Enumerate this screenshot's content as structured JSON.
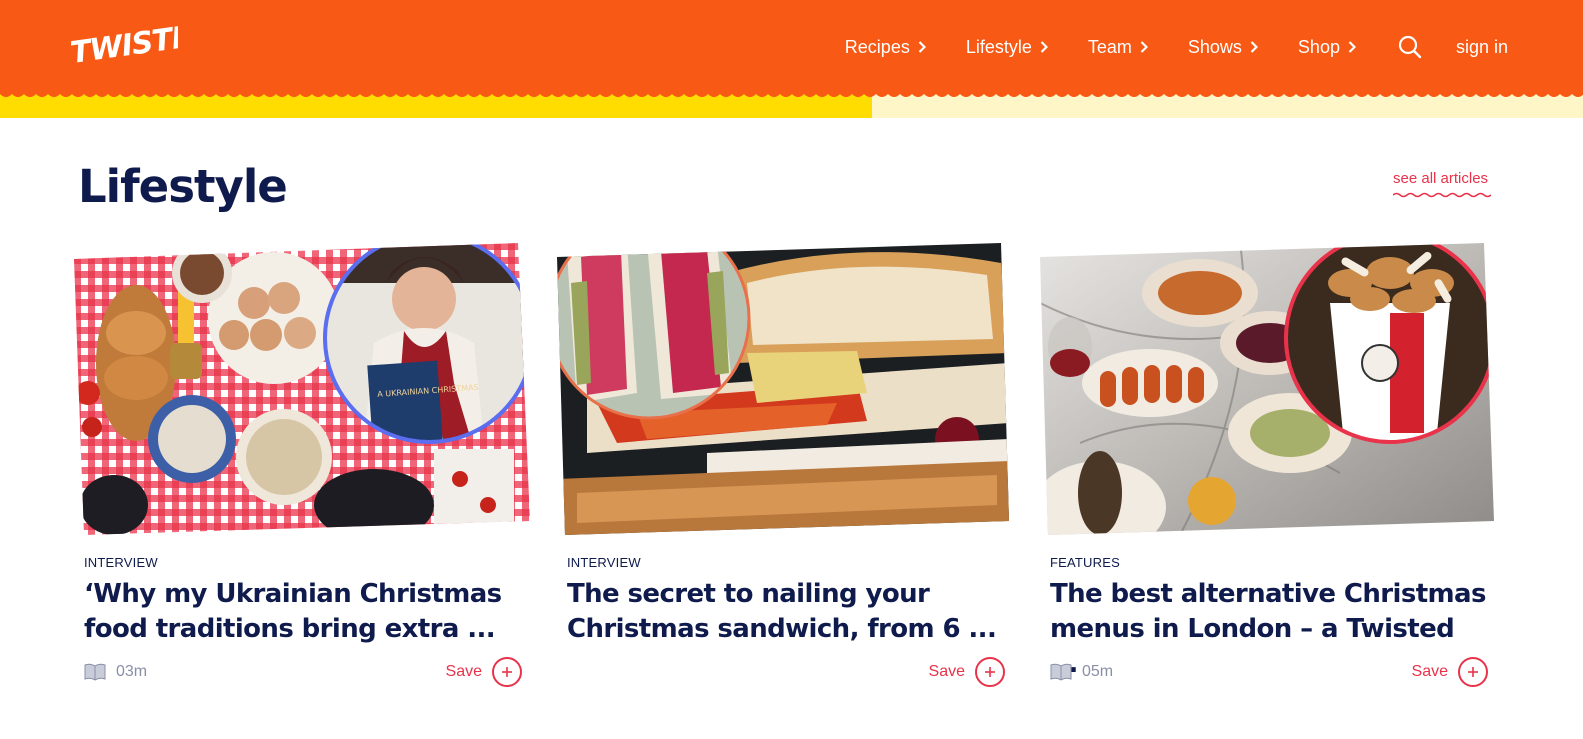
{
  "header": {
    "logo_text": "TWISTED",
    "nav": [
      {
        "label": "Recipes"
      },
      {
        "label": "Lifestyle"
      },
      {
        "label": "Team"
      },
      {
        "label": "Shows"
      },
      {
        "label": "Shop"
      }
    ],
    "search_icon": "search-icon",
    "signin_label": "sign in"
  },
  "section": {
    "title": "Lifestyle",
    "see_all": "see all articles"
  },
  "cards": [
    {
      "tag": "INTERVIEW",
      "title": "‘Why my Ukrainian Christmas food traditions bring extra ...",
      "read_time": "03m",
      "save_label": "Save",
      "book_label": "A UKRAINIAN CHRISTMAS"
    },
    {
      "tag": "INTERVIEW",
      "title": "The secret to nailing your Christmas sandwich, from 6 ...",
      "read_time": "",
      "save_label": "Save"
    },
    {
      "tag": "FEATURES",
      "title": "The best alternative Christmas menus in London – a Twisted ...",
      "read_time": "05m",
      "save_label": "Save"
    }
  ],
  "colors": {
    "brand_orange": "#f85914",
    "brand_yellow": "#ffdd00",
    "pale_yellow": "#fff6c8",
    "navy": "#0f1b4c",
    "accent_red": "#e8334a"
  }
}
